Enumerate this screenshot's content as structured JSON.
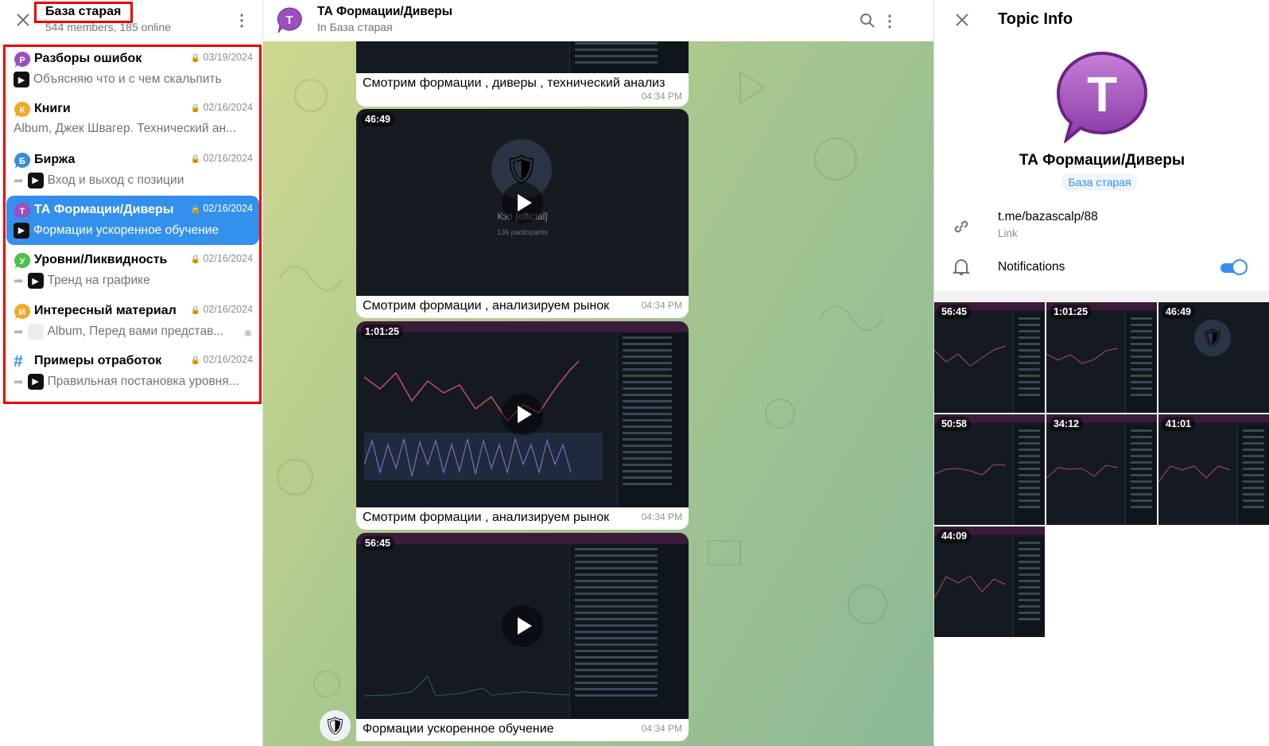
{
  "left": {
    "title": "База старая",
    "subtitle": "544 members, 185 online",
    "topics": [
      {
        "letter": "Р",
        "color": "#9b4fc0",
        "name": "Разборы ошибок",
        "date": "03/19/2024",
        "preview": "Объясняю что и с чем скальпить",
        "forwarded": false
      },
      {
        "letter": "К",
        "color": "#f0a92c",
        "name": "Книги",
        "date": "02/16/2024",
        "preview": "Album, Джек Швагер. Технический ан...",
        "forwarded": false
      },
      {
        "letter": "Б",
        "color": "#3a8fd6",
        "name": "Биржа",
        "date": "02/16/2024",
        "preview": "Вход и выход с позиции",
        "forwarded": true
      },
      {
        "letter": "Т",
        "color": "#9b4fc0",
        "name": "ТА Формации/Диверы",
        "date": "02/16/2024",
        "preview": "Формации ускоренное обучение",
        "forwarded": false
      },
      {
        "letter": "У",
        "color": "#4cbf4c",
        "name": "Уровни/Ликвидность",
        "date": "02/16/2024",
        "preview": "Тренд на графике",
        "forwarded": true
      },
      {
        "letter": "И",
        "color": "#f0a92c",
        "name": "Интересный материал",
        "date": "02/16/2024",
        "preview": "Album, Перед вами представ...",
        "forwarded": true
      },
      {
        "letter": "#",
        "color": "#3390ec",
        "name": "Примеры отработок",
        "date": "02/16/2024",
        "preview": "Правильная постановка уровня...",
        "forwarded": true
      }
    ]
  },
  "chat": {
    "title": "ТА Формации/Диверы",
    "subtitle": "In База старая",
    "avatar_letter": "Т",
    "messages": [
      {
        "caption": "Смотрим формации , диверы , технический анализ",
        "time": "04:34 PM"
      },
      {
        "duration": "46:49",
        "channel": "Кэп [official]",
        "participants": "136 participants",
        "caption": "Смотрим формации , анализируем рынок",
        "time": "04:34 PM"
      },
      {
        "duration": "1:01:25",
        "caption": "Смотрим формации , анализируем рынок",
        "time": "04:34 PM"
      },
      {
        "duration": "56:45",
        "caption": "Формации  ускоренное обучение",
        "time": "04:34 PM"
      }
    ]
  },
  "info": {
    "header": "Topic Info",
    "avatar_letter": "T",
    "title": "ТА Формации/Диверы",
    "group": "База старая",
    "link": "t.me/bazascalp/88",
    "link_label": "Link",
    "notifications_label": "Notifications",
    "notifications_on": true,
    "media": [
      "56:45",
      "1:01:25",
      "46:49",
      "50:58",
      "34:12",
      "41:01",
      "44:09"
    ]
  },
  "colors": {
    "accent": "#3390ec",
    "topic_purple": "#9b4fc0"
  }
}
